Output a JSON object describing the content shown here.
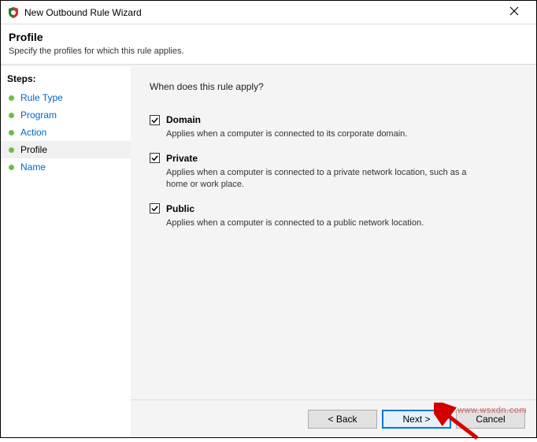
{
  "window": {
    "title": "New Outbound Rule Wizard"
  },
  "header": {
    "title": "Profile",
    "subtitle": "Specify the profiles for which this rule applies."
  },
  "sidebar": {
    "heading": "Steps:",
    "items": [
      {
        "label": "Rule Type",
        "active": false
      },
      {
        "label": "Program",
        "active": false
      },
      {
        "label": "Action",
        "active": false
      },
      {
        "label": "Profile",
        "active": true
      },
      {
        "label": "Name",
        "active": false
      }
    ]
  },
  "content": {
    "prompt": "When does this rule apply?",
    "profiles": [
      {
        "name": "Domain",
        "desc": "Applies when a computer is connected to its corporate domain.",
        "checked": true
      },
      {
        "name": "Private",
        "desc": "Applies when a computer is connected to a private network location, such as a home or work place.",
        "checked": true
      },
      {
        "name": "Public",
        "desc": "Applies when a computer is connected to a public network location.",
        "checked": true
      }
    ]
  },
  "footer": {
    "back": "< Back",
    "next": "Next >",
    "cancel": "Cancel"
  },
  "watermark": "www.wsxdn.com"
}
